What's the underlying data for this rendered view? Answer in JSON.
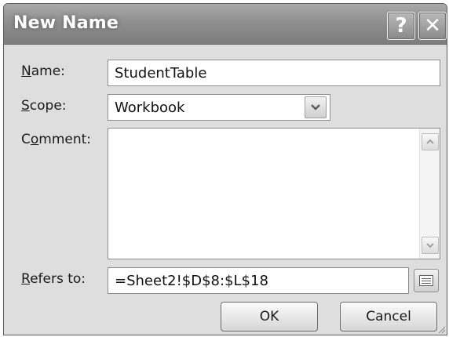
{
  "dialog": {
    "title": "New Name",
    "help_glyph": "?",
    "close_glyph": "✕"
  },
  "form": {
    "name_label_prefix": "",
    "name_label_u": "N",
    "name_label_rest": "ame:",
    "name_value": "StudentTable",
    "scope_label_u": "S",
    "scope_label_rest": "cope:",
    "scope_value": "Workbook",
    "comment_label_pre": "C",
    "comment_label_u": "o",
    "comment_label_rest": "mment:",
    "comment_value": "",
    "refers_label_u": "R",
    "refers_label_rest": "efers to:",
    "refers_value": "=Sheet2!$D$8:$L$18"
  },
  "icons": {
    "scope_dropdown": "chevron-down-icon",
    "scroll_up": "arrow-up-icon",
    "scroll_down": "arrow-down-icon",
    "collapse": "range-collapse-icon"
  },
  "buttons": {
    "ok": "OK",
    "cancel": "Cancel"
  }
}
